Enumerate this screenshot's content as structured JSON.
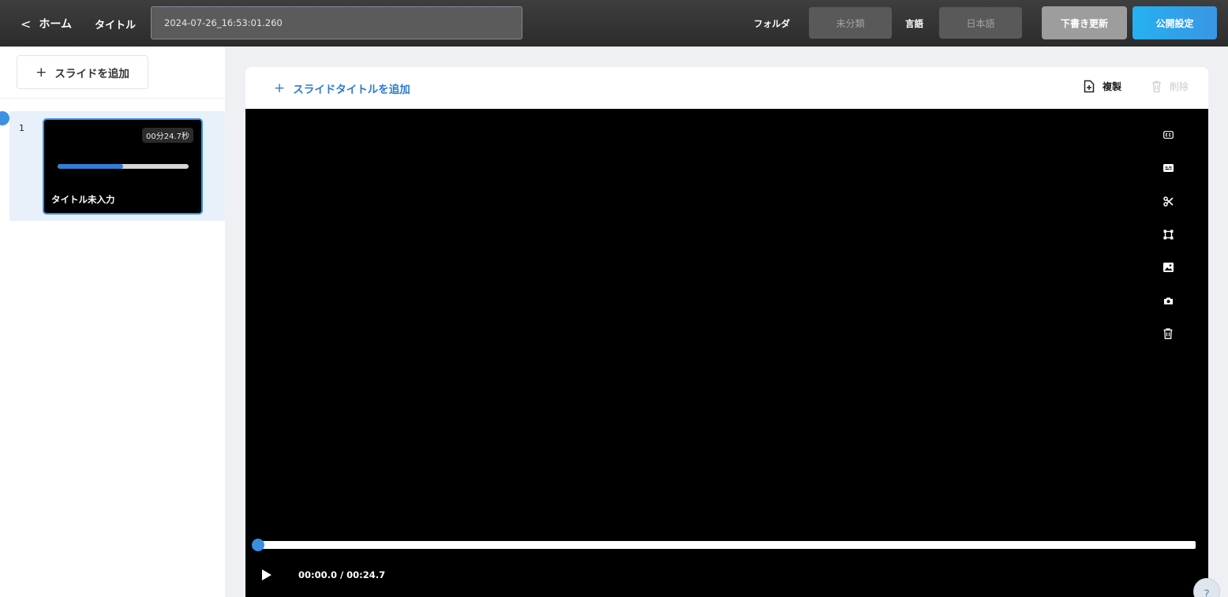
{
  "topbar": {
    "back_chevron": "<",
    "home_label": "ホーム",
    "title_label": "タイトル",
    "title_value": "2024-07-26_16:53:01.260",
    "folder_label": "フォルダ",
    "folder_value": "未分類",
    "language_label": "言語",
    "language_value": "日本語",
    "draft_update_label": "下書き更新",
    "publish_settings_label": "公開設定",
    "colors": {
      "bar": "#333333",
      "publish": "#2aa6ee",
      "draft": "#9d9d9d"
    }
  },
  "sidebar": {
    "add_slide_plus": "+",
    "add_slide_label": "スライドを追加",
    "slides": [
      {
        "number": "1",
        "duration": "00分24.7秒",
        "title": "タイトル未入力",
        "progress": 0.5,
        "selected": true
      }
    ]
  },
  "editor": {
    "add_title_plus": "+",
    "add_title_label": "スライドタイトルを追加",
    "duplicate_label": "複製",
    "delete_label": "削除",
    "tools": [
      "closed-caption-icon",
      "subtitles-icon",
      "scissors-icon",
      "crop-frame-icon",
      "image-icon",
      "camera-icon",
      "trash-icon"
    ],
    "player": {
      "time": "00:00.0 / 00:24.7",
      "position": 0.0
    }
  },
  "help": {
    "label": "?"
  }
}
